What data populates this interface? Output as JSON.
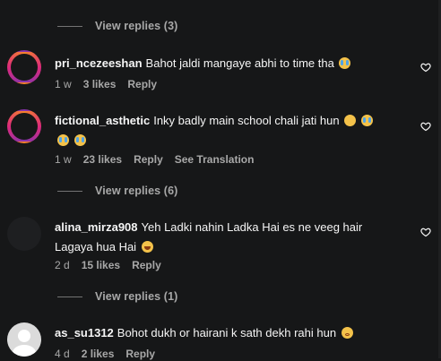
{
  "top_view_replies": "View replies (3)",
  "comments": [
    {
      "username": "pri_ncezeeshan",
      "text": "Bahot jaldi mangaye abhi to time tha",
      "time": "1 w",
      "likes": "3 likes",
      "reply": "Reply",
      "avatar": "gradient-ring-avatar"
    },
    {
      "username": "fictional_asthetic",
      "text": "Inky badly main school chali jati hun",
      "time": "1 w",
      "likes": "23 likes",
      "reply": "Reply",
      "translation": "See Translation",
      "view_replies": "View replies (6)",
      "avatar": "gradient-ring-avatar"
    },
    {
      "username": "alina_mirza908",
      "text": "Yeh Ladki nahin Ladka Hai es ne veeg hair Lagaya hua Hai",
      "time": "2 d",
      "likes": "15 likes",
      "reply": "Reply",
      "view_replies": "View replies (1)",
      "avatar": "dark-avatar"
    },
    {
      "username": "as_su1312",
      "text": "Bohot dukh or hairani k sath dekh rahi hun",
      "time": "4 d",
      "likes": "2 likes",
      "reply": "Reply",
      "avatar": "default-person-avatar"
    }
  ],
  "icons": {
    "like": "heart-icon",
    "emoji_cry": "crying-face-emoji",
    "emoji_sad": "sad-face-emoji",
    "emoji_laugh": "laughing-face-emoji",
    "emoji_flushed": "flushed-face-emoji"
  },
  "colors": {
    "background": "#161718",
    "text": "#f5f5f5",
    "secondary_text": "#a8a8a8",
    "ring": "#c13584"
  }
}
